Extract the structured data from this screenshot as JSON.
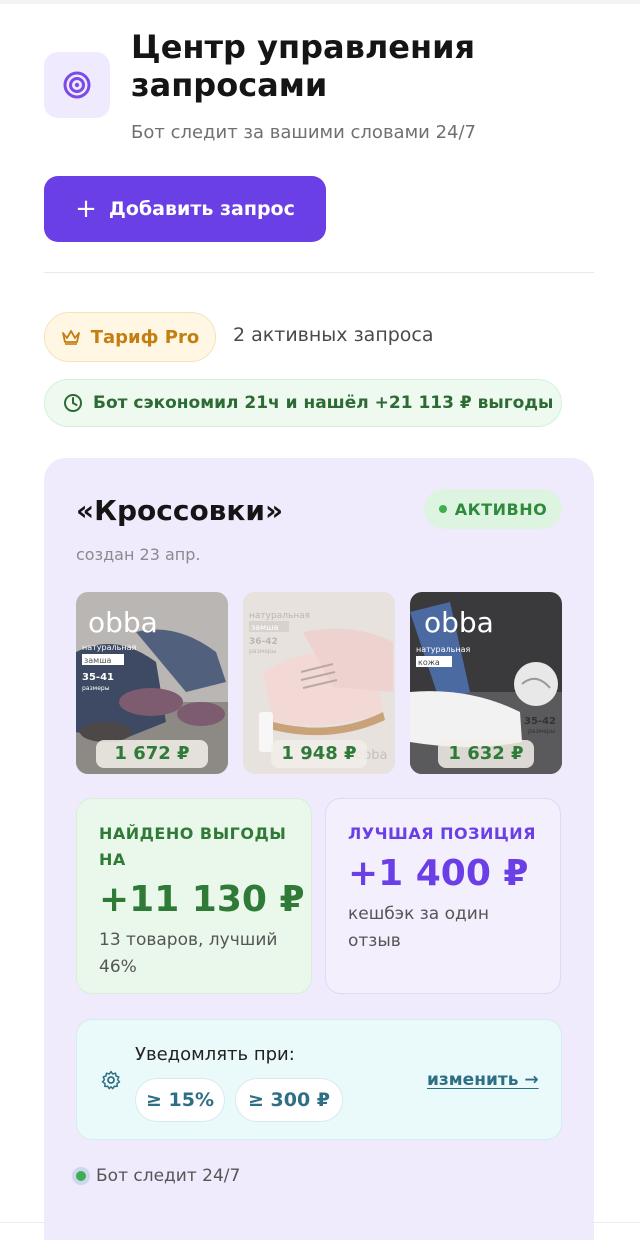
{
  "header": {
    "title": "Центр управления запросами",
    "subtitle": "Бот следит за вашими словами 24/7",
    "logo_icon": "target-icon"
  },
  "actions": {
    "add_label": "Добавить запрос"
  },
  "plan": {
    "tariff_label": "Тариф Pro",
    "active_requests": "2 активных запроса",
    "savings": "Бот сэкономил 21ч и нашёл +21 113 ₽ выгоды"
  },
  "request": {
    "title": "«Кроссовки»",
    "status": "АКТИВНО",
    "created": "создан 23 апр.",
    "products": [
      {
        "price": "1 672 ₽",
        "brand": "obba",
        "tag1": "натуральная",
        "tag2": "замша",
        "sizes": "35-41",
        "sizes_label": "размеры"
      },
      {
        "price": "1 948 ₽",
        "brand": "obba",
        "tag1": "натуральная",
        "tag2": "замша",
        "sizes": "36-42",
        "sizes_label": "размеры"
      },
      {
        "price": "1 632 ₽",
        "brand": "obba",
        "tag1": "натуральная",
        "tag2": "кожа",
        "sizes": "35-42",
        "sizes_label": "размеры"
      }
    ],
    "stats": {
      "found_label": "НАЙДЕНО ВЫГОДЫ НА",
      "found_value": "+11 130 ₽",
      "found_note": "13 товаров, лучший 46%",
      "best_label": "ЛУЧШАЯ ПОЗИЦИЯ",
      "best_value": "+1 400 ₽",
      "best_note": "кешбэк за один отзыв"
    },
    "notify": {
      "label": "Уведомлять при:",
      "threshold_percent": "≥ 15%",
      "threshold_amount": "≥ 300 ₽",
      "change_label": "изменить →"
    },
    "tracking": "Бот следит 24/7"
  },
  "colors": {
    "accent": "#6a3fe6",
    "success": "#2f7a37",
    "card_bg": "#efeafc",
    "tariff": "#c47f12"
  }
}
